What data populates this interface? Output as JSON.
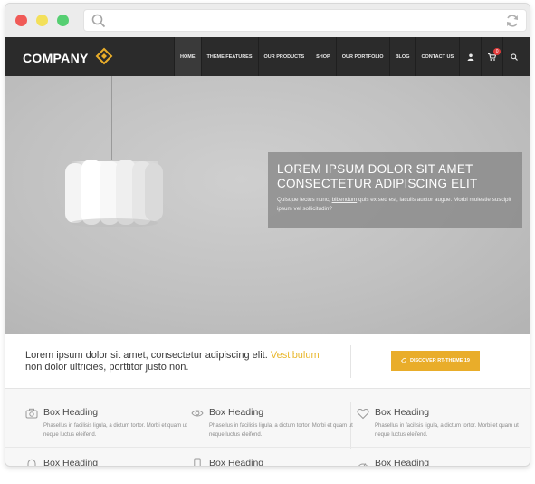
{
  "browser": {
    "search_icon": "search-icon",
    "reload_icon": "reload-icon"
  },
  "header": {
    "logo": "COMPANY",
    "nav": [
      {
        "label": "HOME"
      },
      {
        "label": "THEME FEATURES"
      },
      {
        "label": "OUR PRODUCTS"
      },
      {
        "label": "SHOP"
      },
      {
        "label": "OUR PORTFOLIO"
      },
      {
        "label": "BLOG"
      },
      {
        "label": "CONTACT US"
      }
    ],
    "cart_count": "0",
    "colors": {
      "accent": "#e9ad2a",
      "nav_bg": "#2b2b2b"
    }
  },
  "hero": {
    "title_line1": "LOREM IPSUM DOLOR SIT AMET",
    "title_line2": "CONSECTETUR ADIPISCING ELIT",
    "text_before": "Quisque lectus nunc, ",
    "text_link": "bibendum",
    "text_after": " quis ex sed est, iaculis auctor augue. Morbi molestie suscipit ipsum vel sollicitudin?"
  },
  "promo": {
    "text": "Lorem ipsum dolor sit amet, consectetur adipiscing elit. ",
    "accent": "Vestibulum",
    "text2": " non dolor ultricies, porttitor justo non.",
    "button": "DISCOVER RT-THEME 19"
  },
  "boxes": [
    {
      "heading": "Box Heading",
      "text": "Phasellus in facilisis ligula, a dictum tortor. Morbi et quam ut neque luctus eleifend.",
      "icon": "camera-icon"
    },
    {
      "heading": "Box Heading",
      "text": "Phasellus in facilisis ligula, a dictum tortor. Morbi et quam ut neque luctus eleifend.",
      "icon": "eye-icon"
    },
    {
      "heading": "Box Heading",
      "text": "Phasellus in facilisis ligula, a dictum tortor. Morbi et quam ut neque luctus eleifend.",
      "icon": "heart-icon"
    },
    {
      "heading": "Box Heading",
      "icon": "bell-icon"
    },
    {
      "heading": "Box Heading",
      "icon": "mobile-icon"
    },
    {
      "heading": "Box Heading",
      "icon": "gauge-icon"
    }
  ]
}
